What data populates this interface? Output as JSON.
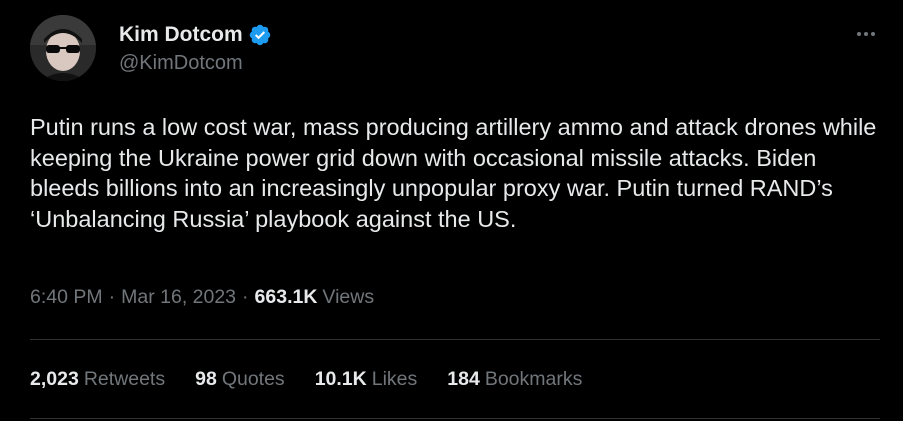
{
  "author": {
    "display_name": "Kim Dotcom",
    "handle": "@KimDotcom",
    "verified_icon": "verified-badge-icon",
    "verified_color": "#1d9bf0"
  },
  "tweet": {
    "text": "Putin runs a low cost war, mass producing artillery ammo and attack drones while keeping the Ukraine power grid down with occasional missile attacks. Biden bleeds billions into an increasingly unpopular proxy war. Putin turned RAND’s ‘Unbalancing Russia’ playbook against the US.",
    "time": "6:40 PM",
    "date": "Mar 16, 2023",
    "separator": "·",
    "views_count": "663.1K",
    "views_label": "Views"
  },
  "stats": [
    {
      "count": "2,023",
      "label": "Retweets"
    },
    {
      "count": "98",
      "label": "Quotes"
    },
    {
      "count": "10.1K",
      "label": "Likes"
    },
    {
      "count": "184",
      "label": "Bookmarks"
    }
  ],
  "colors": {
    "background": "#000000",
    "primary_text": "#e7e9ea",
    "secondary_text": "#71767b",
    "divider": "#2f3336"
  }
}
